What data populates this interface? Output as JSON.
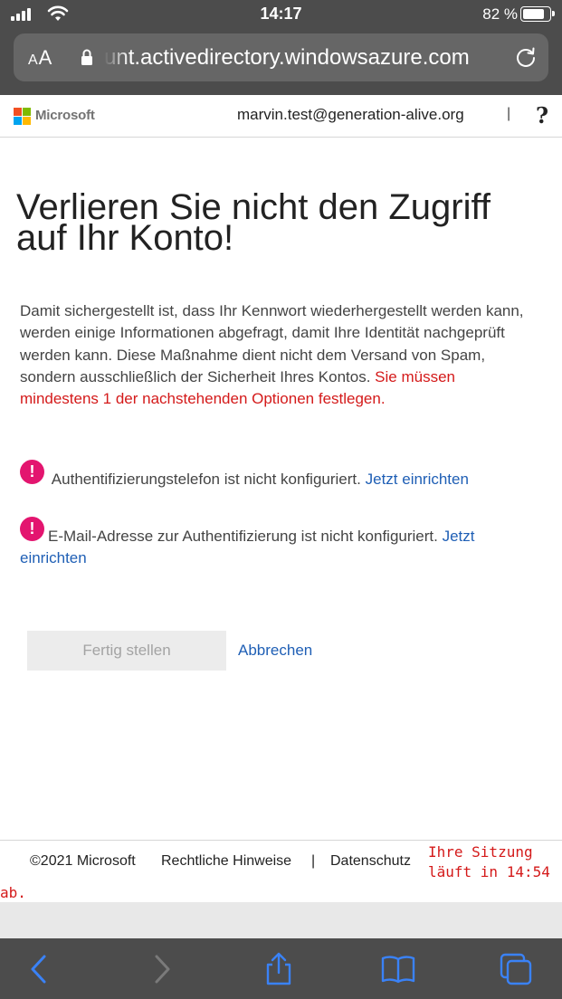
{
  "status_bar": {
    "time": "14:17",
    "battery_percent": "82 %",
    "battery_level": 0.82
  },
  "browser": {
    "text_size_label": "AA",
    "url": "unt.activedirectory.windowsazure.com"
  },
  "header": {
    "brand": "Microsoft",
    "account": "marvin.test@generation-alive.org",
    "separator": "|",
    "help": "?"
  },
  "main": {
    "title": "Verlieren Sie nicht den Zugriff auf Ihr Konto!",
    "intro": "Damit sichergestellt ist, dass Ihr Kennwort wiederhergestellt werden kann, werden einige Informationen abgefragt, damit Ihre Identität nachgeprüft werden kann. Diese Maßnahme dient nicht dem Versand von Spam, sondern ausschließlich der Sicherheit Ihres Kontos.",
    "requirement": "Sie müssen mindestens 1 der nachstehenden Optionen festlegen.",
    "warnings": [
      {
        "icon": "!",
        "text": "Authentifizierungstelefon ist nicht konfiguriert.",
        "link": "Jetzt einrichten"
      },
      {
        "icon": "!",
        "text": "E-Mail-Adresse zur Authentifizierung ist nicht konfiguriert.",
        "link": "Jetzt einrichten"
      }
    ],
    "finish_button": "Fertig stellen",
    "cancel_link": "Abbrechen"
  },
  "footer": {
    "copyright": "©2021 Microsoft",
    "legal": "Rechtliche Hinweise",
    "separator": "|",
    "privacy": "Datenschutz",
    "session_line1": "Ihre Sitzung",
    "session_line2": "läuft in 14:54",
    "session_line3": "ab."
  },
  "colors": {
    "ios_chrome": "#4c4c4c",
    "link_blue": "#1f5fb5",
    "error_red": "#d41a1a",
    "warning_pink": "#e3156f",
    "ios_tint": "#3a82f7"
  },
  "icons": [
    "signal-icon",
    "wifi-icon",
    "battery-icon",
    "lock-icon",
    "reload-icon",
    "microsoft-logo",
    "warning-icon",
    "back-icon",
    "forward-icon",
    "share-icon",
    "bookmarks-icon",
    "tabs-icon"
  ]
}
